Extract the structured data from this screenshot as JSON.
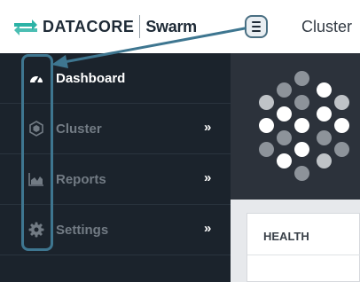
{
  "header": {
    "brand_name": "DATACORE",
    "product_name": "Swarm",
    "menu_icon": "hamburger-menu-icon",
    "page_title": "Cluster"
  },
  "sidebar": {
    "items": [
      {
        "label": "Dashboard",
        "icon": "dashboard-gauge-icon",
        "active": true,
        "submenu": ""
      },
      {
        "label": "Cluster",
        "icon": "cluster-hexagon-icon",
        "active": false,
        "submenu": "»"
      },
      {
        "label": "Reports",
        "icon": "area-chart-icon",
        "active": false,
        "submenu": "»"
      },
      {
        "label": "Settings",
        "icon": "gear-icon",
        "active": false,
        "submenu": "»"
      }
    ]
  },
  "main": {
    "health_card_title": "HEALTH"
  },
  "colors": {
    "sidebar_bg": "#1b232c",
    "brand_teal": "#2cb3a6",
    "annotation": "#3e7690",
    "hero_bg": "#2c323b"
  }
}
